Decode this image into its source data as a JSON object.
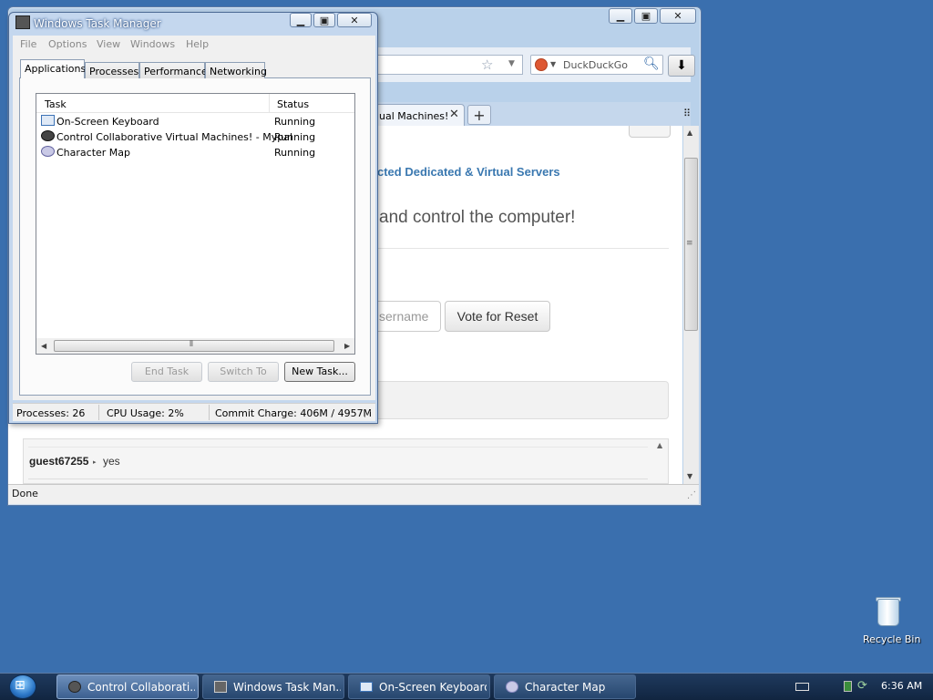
{
  "browser": {
    "search_placeholder": "DuckDuckGo",
    "active_tab_label": "ual Machines!",
    "new_tab": "+",
    "heading_link": "cted Dedicated & Virtual Servers",
    "big_text": "and control the computer!",
    "username_placeholder": "sername",
    "vote_button": "Vote for Reset",
    "chat": {
      "user": "guest67255",
      "arrow": "▸",
      "message": "yes"
    },
    "status": "Done",
    "icons": {
      "star": "star-icon",
      "dropdown": "chevron-down-icon",
      "search_engine": "duckduckgo-icon",
      "search": "magnifier-icon",
      "download": "download-icon",
      "tab_close": "close-icon",
      "all_tabs": "grid-icon"
    }
  },
  "task_manager": {
    "title": "Windows Task Manager",
    "menu": [
      "File",
      "Options",
      "View",
      "Windows",
      "Help"
    ],
    "tabs": [
      "Applications",
      "Processes",
      "Performance",
      "Networking"
    ],
    "active_tab": "Applications",
    "columns": {
      "task": "Task",
      "status": "Status"
    },
    "rows": [
      {
        "name": "On-Screen Keyboard",
        "status": "Running",
        "icon": "keyboard-icon"
      },
      {
        "name": "Control Collaborative Virtual Machines! - Mypal",
        "status": "Running",
        "icon": "raccoon-browser-icon"
      },
      {
        "name": "Character Map",
        "status": "Running",
        "icon": "character-map-icon"
      }
    ],
    "buttons": {
      "end_task": "End Task",
      "switch_to": "Switch To",
      "new_task": "New Task..."
    },
    "statusbar": {
      "processes": "Processes: 26",
      "cpu": "CPU Usage: 2%",
      "commit": "Commit Charge: 406M / 4957M"
    }
  },
  "desktop": {
    "recycle_bin_label": "Recycle Bin"
  },
  "taskbar": {
    "items": [
      {
        "label": "Control Collaborati...",
        "icon": "raccoon-browser-icon",
        "active": true
      },
      {
        "label": "Windows Task Man...",
        "icon": "task-manager-icon",
        "active": false
      },
      {
        "label": "On-Screen Keyboard",
        "icon": "keyboard-icon",
        "active": false
      },
      {
        "label": "Character Map",
        "icon": "character-map-icon",
        "active": false
      }
    ],
    "clock": "6:36 AM"
  },
  "colors": {
    "desktop": "#3a6fae",
    "link": "#3a78b0",
    "taskbar": "#1a3253"
  }
}
